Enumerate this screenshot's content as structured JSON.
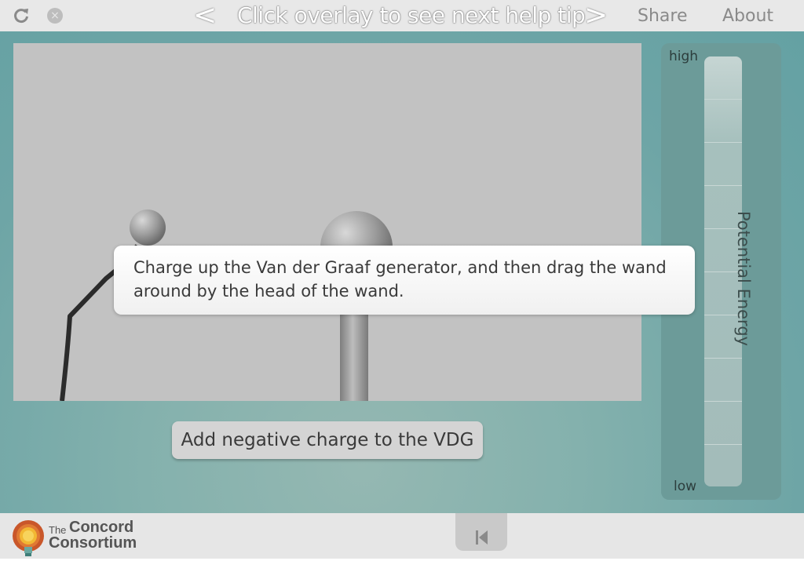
{
  "topbar": {
    "reload_icon": "reload-icon",
    "close_icon": "close-icon",
    "prev_label": "<",
    "next_label": ">",
    "help_title": "Click overlay to see next help tip",
    "share_label": "Share",
    "about_label": "About"
  },
  "tooltip": {
    "text": "Charge up the Van der Graaf generator, and then drag the wand around by the head of the wand."
  },
  "controls": {
    "add_charge_label": "Add negative charge to the VDG"
  },
  "potential_energy": {
    "label": "Potential Energy",
    "high_label": "high",
    "low_label": "low",
    "level": 0
  },
  "footer": {
    "logo_the": "The",
    "logo_concord": "Concord",
    "logo_consortium": "Consortium",
    "reset_icon": "skip-to-start-icon"
  },
  "colors": {
    "topbar_bg": "#e8e8e8",
    "main_bg": "#84b1ad",
    "canvas_bg": "#c2c2c2",
    "panel_bg": "#6c9b99"
  }
}
